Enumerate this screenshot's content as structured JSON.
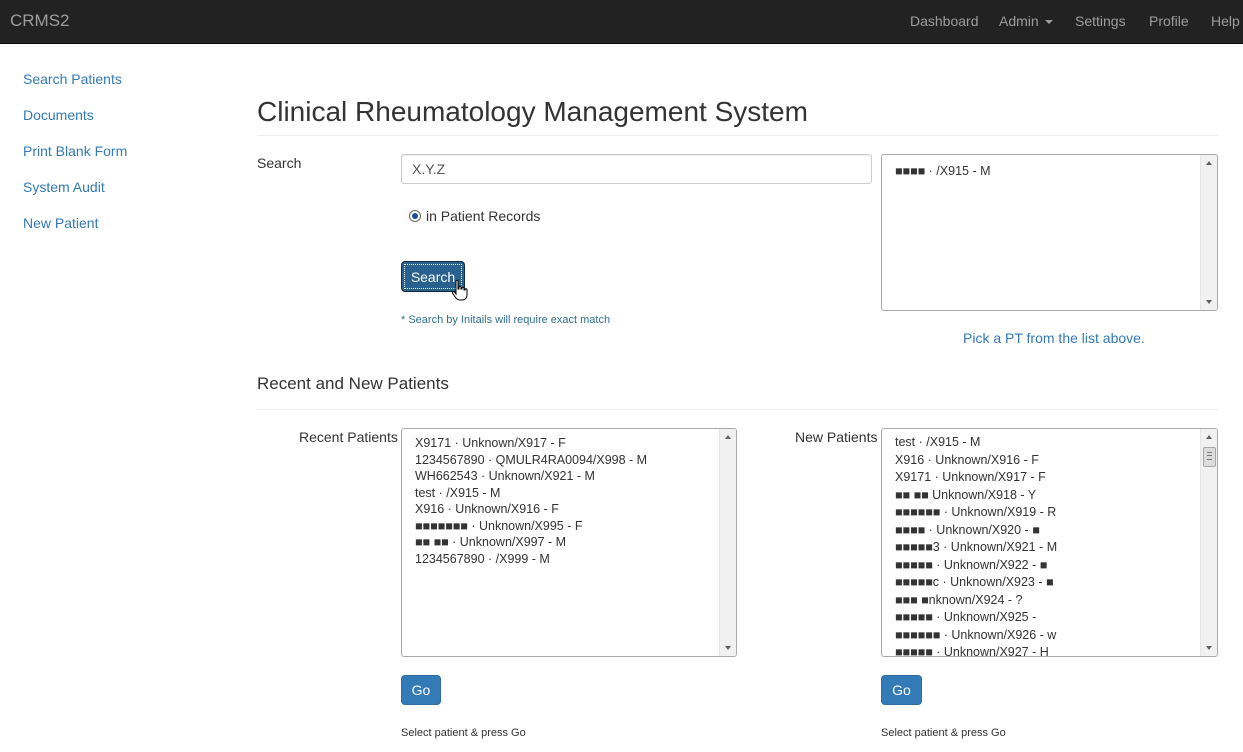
{
  "nav": {
    "brand": "CRMS2",
    "links": [
      {
        "label": "Dashboard"
      },
      {
        "label": "Admin"
      },
      {
        "label": "Settings"
      },
      {
        "label": "Profile"
      },
      {
        "label": "Help"
      }
    ]
  },
  "sidebar": {
    "items": [
      {
        "label": "Search Patients"
      },
      {
        "label": "Documents"
      },
      {
        "label": "Print Blank Form"
      },
      {
        "label": "System Audit"
      },
      {
        "label": "New Patient"
      }
    ]
  },
  "page": {
    "title": "Clinical Rheumatology Management System"
  },
  "search": {
    "label": "Search",
    "value": "X.Y.Z",
    "radio_label": "in Patient Records",
    "button": "Search",
    "helper": "* Search by Initails will require exact match",
    "results": [
      "■■■■ · /X915 - M"
    ],
    "pick_hint": "Pick a PT from the list above."
  },
  "recent_section": {
    "title": "Recent and New Patients"
  },
  "recent": {
    "label": "Recent Patients",
    "items": [
      "X9171 · Unknown/X917 - F",
      "1234567890 · QMULR4RA0094/X998 - M",
      "WH662543 · Unknown/X921 - M",
      "test · /X915 - M",
      "X916 · Unknown/X916 - F",
      "■■■■■■■ · Unknown/X995 - F",
      "■■ ■■ · Unknown/X997 - M",
      "1234567890 · /X999 - M"
    ],
    "go": "Go",
    "helper": "Select patient & press Go"
  },
  "new": {
    "label": "New Patients",
    "items": [
      "test · /X915 - M",
      "X916 · Unknown/X916 - F",
      "X9171 · Unknown/X917 - F",
      "■■ ■■ Unknown/X918 - Y",
      "■■■■■■ · Unknown/X919 - R",
      "■■■■ · Unknown/X920 - ■",
      "■■■■■3 · Unknown/X921 - M",
      "■■■■■ · Unknown/X922 - ■",
      "■■■■■c · Unknown/X923 - ■",
      "■■■ ■nknown/X924 - ?",
      "■■■■■ · Unknown/X925 -",
      "■■■■■■ · Unknown/X926 - w",
      "■■■■■ · Unknown/X927 - H"
    ],
    "go": "Go",
    "helper": "Select patient & press Go"
  }
}
